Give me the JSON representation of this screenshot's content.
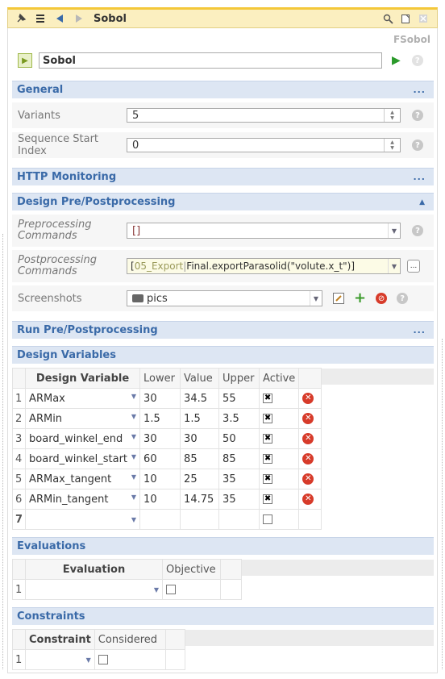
{
  "titlebar": {
    "title": "Sobol",
    "left_icons": [
      "pin-icon",
      "menu-icon",
      "back-icon",
      "forward-icon"
    ],
    "right_icons": [
      "search-icon",
      "window-icon",
      "close-icon"
    ]
  },
  "type_label": "FSobol",
  "name_row": {
    "value": "Sobol",
    "help": "?"
  },
  "sections": {
    "general": "General",
    "http": "HTTP Monitoring",
    "design_pre": "Design Pre/Postprocessing",
    "run_pre": "Run Pre/Postprocessing",
    "design_vars": "Design Variables",
    "evaluations": "Evaluations",
    "constraints": "Constraints",
    "collapsed_marker": "...",
    "expanded_marker": "▲"
  },
  "general": {
    "variants_label": "Variants",
    "variants_value": "5",
    "seq_label": "Sequence Start Index",
    "seq_value": "0"
  },
  "design_pre": {
    "pre_label": "Preprocessing Commands",
    "pre_value": "[]",
    "post_label": "Postprocessing Commands",
    "post_prefix": "05_Export",
    "post_sep": "|",
    "post_value": "Final.exportParasolid(\"volute.x_t\")]",
    "post_open": "[",
    "post_more": "...",
    "screens_label": "Screenshots",
    "screens_value": "pics"
  },
  "design_vars": {
    "headers": [
      "Design Variable",
      "Lower",
      "Value",
      "Upper",
      "Active"
    ],
    "rows": [
      {
        "idx": "1",
        "name": "ARMax",
        "lower": "30",
        "value": "34.5",
        "upper": "55",
        "active": "✖"
      },
      {
        "idx": "2",
        "name": "ARMin",
        "lower": "1.5",
        "value": "1.5",
        "upper": "3.5",
        "active": "✖"
      },
      {
        "idx": "3",
        "name": "board_winkel_end",
        "lower": "30",
        "value": "30",
        "upper": "50",
        "active": "✖"
      },
      {
        "idx": "4",
        "name": "board_winkel_start",
        "lower": "60",
        "value": "85",
        "upper": "85",
        "active": "✖"
      },
      {
        "idx": "5",
        "name": "ARMax_tangent",
        "lower": "10",
        "value": "25",
        "upper": "35",
        "active": "✖"
      },
      {
        "idx": "6",
        "name": "ARMin_tangent",
        "lower": "10",
        "value": "14.75",
        "upper": "35",
        "active": "✖"
      }
    ],
    "new_row_idx": "7"
  },
  "evaluations": {
    "headers": [
      "Evaluation",
      "Objective"
    ],
    "row_idx": "1"
  },
  "constraints": {
    "headers": [
      "Constraint",
      "Considered"
    ],
    "row_idx": "1"
  },
  "colors": {
    "section_bg": "#dde6f3",
    "section_text": "#3a6aa8",
    "title_bg": "#fbefc0",
    "run_green": "#2a9a2a",
    "delete_red": "#d73b2a"
  }
}
